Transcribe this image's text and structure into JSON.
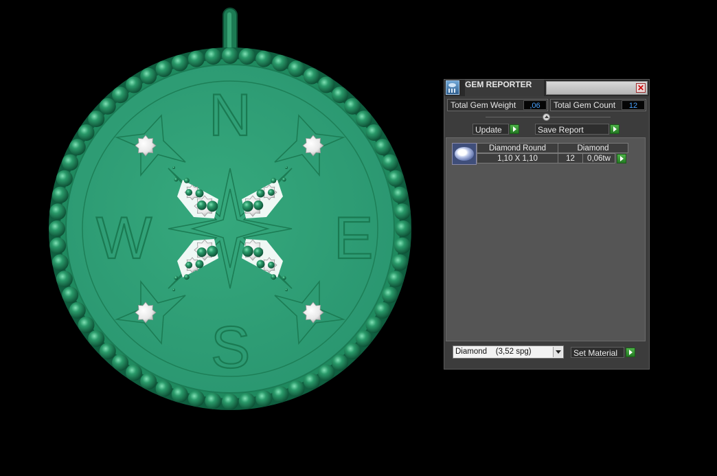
{
  "viewport": {
    "compass_letters": {
      "north": "N",
      "south": "S",
      "east": "E",
      "west": "W"
    },
    "colors": {
      "metal": "#2e9e73",
      "metal_dark": "#0f6a47",
      "bead": "#1b7a52",
      "gem": "#f2f2f2",
      "background": "#000000"
    }
  },
  "panel": {
    "title": "GEM REPORTER",
    "close_icon": "close-icon",
    "total_weight_label": "Total Gem Weight",
    "total_weight_value": ",06",
    "total_count_label": "Total Gem Count",
    "total_count_value": "12",
    "update_label": "Update",
    "save_report_label": "Save Report",
    "gems": [
      {
        "shape": "Diamond Round",
        "size": "1,10 X 1,10",
        "material": "Diamond",
        "count": "12",
        "weight": "0,06tw"
      }
    ],
    "material_select": "Diamond    (3,52 spg)",
    "set_material_label": "Set Material",
    "colors": {
      "value_text": "#4aa3ff",
      "go_button": "#3a9a35",
      "list_bg": "#555555"
    }
  }
}
